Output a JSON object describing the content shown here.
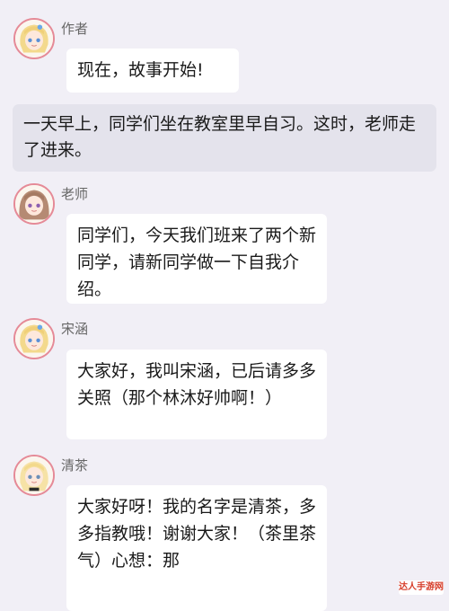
{
  "messages": [
    {
      "sender": "作者",
      "text": "现在，故事开始!"
    },
    {
      "sender": "老师",
      "text": "同学们，今天我们班来了两个新同学，请新同学做一下自我介绍。"
    },
    {
      "sender": "宋涵",
      "text": "大家好，我叫宋涵，已后请多多关照（那个林沐好帅啊！）"
    },
    {
      "sender": "清茶",
      "text": "大家好呀！我的名字是清茶，多多指教哦！谢谢大家！（茶里茶气）心想：那"
    }
  ],
  "narration": "一天早上，同学们坐在教室里早自习。这时，老师走了进来。",
  "watermark": "达人手游网",
  "colors": {
    "background": "#f1eff6",
    "bubble": "#ffffff",
    "narration_bg": "#e4e3ec",
    "avatar_border": "#e58a97"
  },
  "icons": {
    "author_avatar": "blonde-anime-girl-avatar-icon",
    "teacher_avatar": "brown-haired-anime-girl-avatar-icon",
    "songhan_avatar": "blonde-anime-girl-avatar-icon",
    "qingcha_avatar": "blonde-anime-girl-avatar-icon"
  }
}
